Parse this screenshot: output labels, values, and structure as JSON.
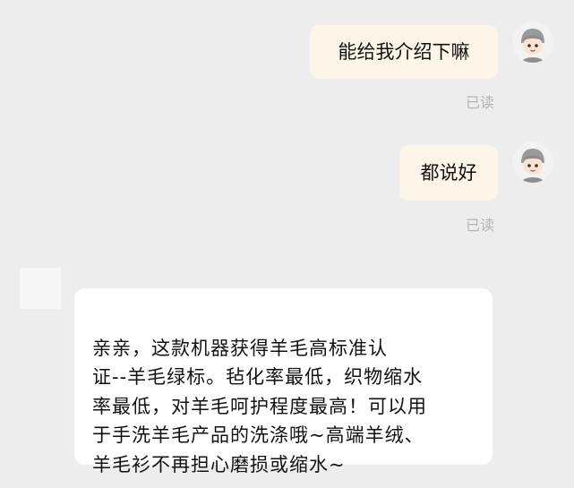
{
  "messages": [
    {
      "id": "m1",
      "sender": "self",
      "text": "能给我介绍下嘛",
      "status": "已读"
    },
    {
      "id": "m2",
      "sender": "self",
      "text": "都说好",
      "status": "已读"
    },
    {
      "id": "m3",
      "sender": "peer",
      "text": "亲亲，这款机器获得羊毛高标准认\n证--羊毛绿标。毡化率最低，织物缩水\n率最低，对羊毛呵护程度最高！可以用\n于手洗羊毛产品的洗涤哦~高端羊绒、\n羊毛衫不再担心磨损或缩水~"
    }
  ],
  "colors": {
    "background": "#ededed",
    "outgoing_bubble": "#fdf6e8",
    "incoming_bubble": "#ffffff",
    "read_status": "#b3b3b3"
  },
  "icons": {
    "self_avatar": "cartoon-boy-avatar-icon",
    "peer_avatar": "blank-avatar"
  }
}
